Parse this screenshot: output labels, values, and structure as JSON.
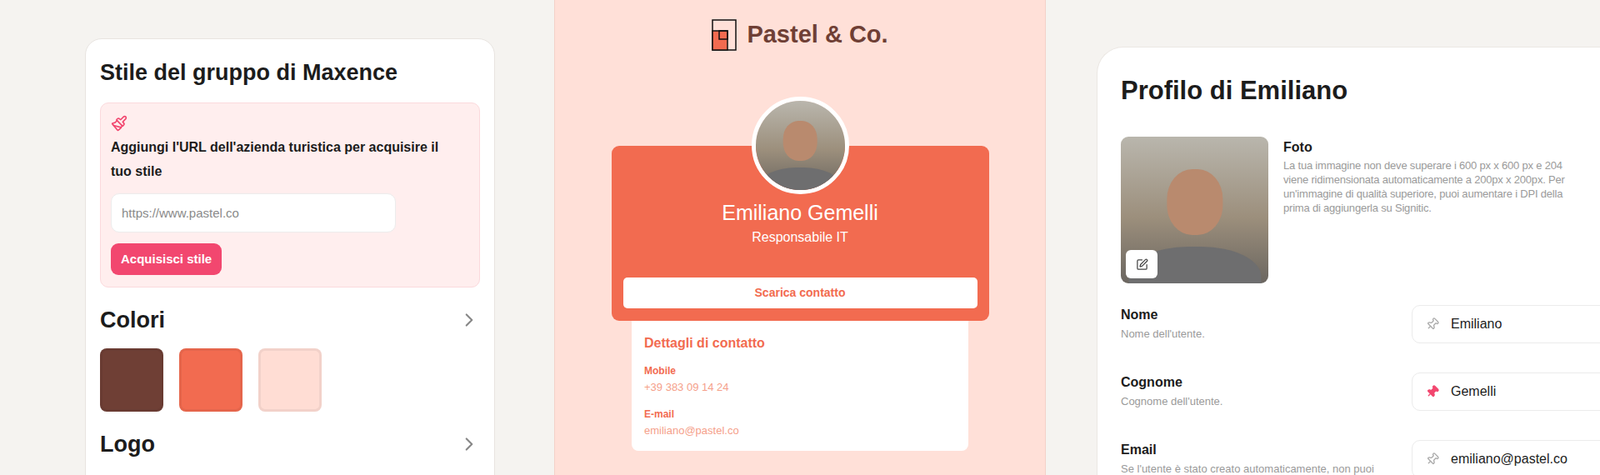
{
  "left_panel": {
    "title": "Stile del gruppo di Maxence",
    "import": {
      "label": "Aggiungi l'URL dell'azienda turistica per acquisire il tuo stile",
      "placeholder": "https://www.pastel.co",
      "button": "Acquisisci stile"
    },
    "colors_section": {
      "title": "Colori",
      "swatches": [
        {
          "color": "#6f3f35"
        },
        {
          "color": "#f26b50"
        },
        {
          "color": "#ffddd4"
        }
      ]
    },
    "logo_section": {
      "title": "Logo"
    }
  },
  "preview": {
    "brand": "Pastel & Co.",
    "name": "Emiliano Gemelli",
    "role": "Responsabile IT",
    "button": "Scarica contatto",
    "details_title": "Dettagli di contatto",
    "details": [
      {
        "label": "Mobile",
        "value": "+39 383 09 14 24"
      },
      {
        "label": "E-mail",
        "value": "emiliano@pastel.co"
      }
    ]
  },
  "profile": {
    "title": "Profilo di Emiliano",
    "photo": {
      "label": "Foto",
      "description": [
        "La tua immagine non deve superare i 600 px x 600 px e 204",
        "viene ridimensionata automaticamente a 200px x 200px. Per",
        "un'immagine di qualità superiore, puoi aumentare i DPI della",
        "prima di aggiungerla su Signitic."
      ]
    },
    "fields": [
      {
        "label": "Nome",
        "hint": "Nome dell'utente.",
        "value": "Emiliano",
        "pinned": false
      },
      {
        "label": "Cognome",
        "hint": "Cognome dell'utente.",
        "value": "Gemelli",
        "pinned": true
      },
      {
        "label": "Email",
        "hint": "Se l'utente è stato creato automaticamente, non puoi",
        "value": "emiliano@pastel.co",
        "pinned": false
      }
    ]
  }
}
